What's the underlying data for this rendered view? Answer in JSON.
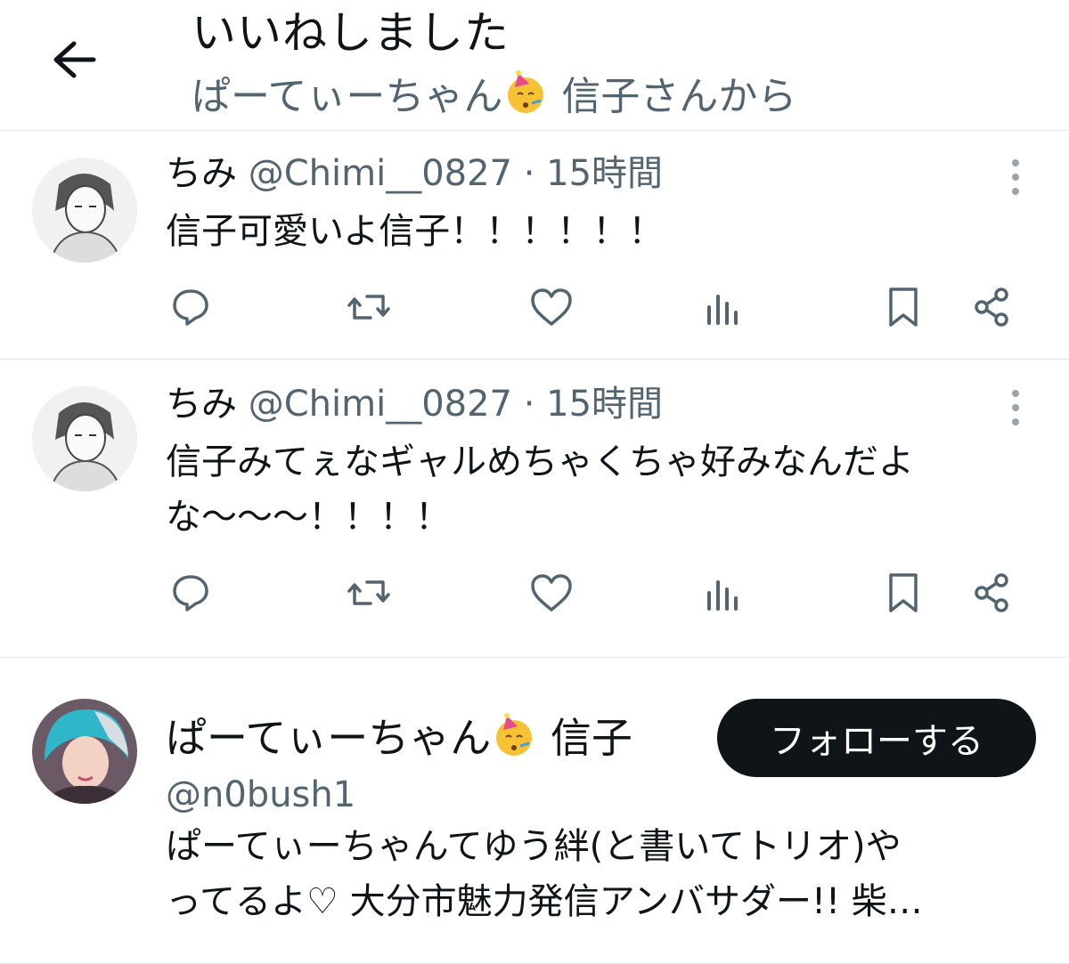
{
  "header": {
    "title": "いいねしました",
    "subtitle_name": "ぱーてぃーちゃん",
    "subtitle_rest": " 信子さんから"
  },
  "tweets": [
    {
      "name": "ちみ",
      "handle": "@Chimi__0827",
      "separator": "·",
      "time": "15時間",
      "text": "信子可愛いよ信子！！！！！！"
    },
    {
      "name": "ちみ",
      "handle": "@Chimi__0827",
      "separator": "·",
      "time": "15時間",
      "text": "信子みてぇなギャルめちゃくちゃ好みなんだよな〜〜〜！！！！"
    }
  ],
  "user": {
    "name_part": "ぱーてぃーちゃん",
    "name_rest": " 信子",
    "handle": "@n0bush1",
    "follow_label": "フォローする",
    "bio_line1": "ぱーてぃーちゃんてゆう絆(と書いてトリオ)や",
    "bio_line2": "ってるよ♡ 大分市魅力発信アンバサダー!! 柴…"
  },
  "icons": [
    "back-arrow-icon",
    "party-face-emoji",
    "more-icon",
    "reply-icon",
    "retweet-icon",
    "like-icon",
    "views-icon",
    "bookmark-icon",
    "share-icon"
  ],
  "colors": {
    "text": "#0f1419",
    "secondary": "#536471",
    "divider": "#e6e9ec",
    "follow_bg": "#0f1419"
  }
}
